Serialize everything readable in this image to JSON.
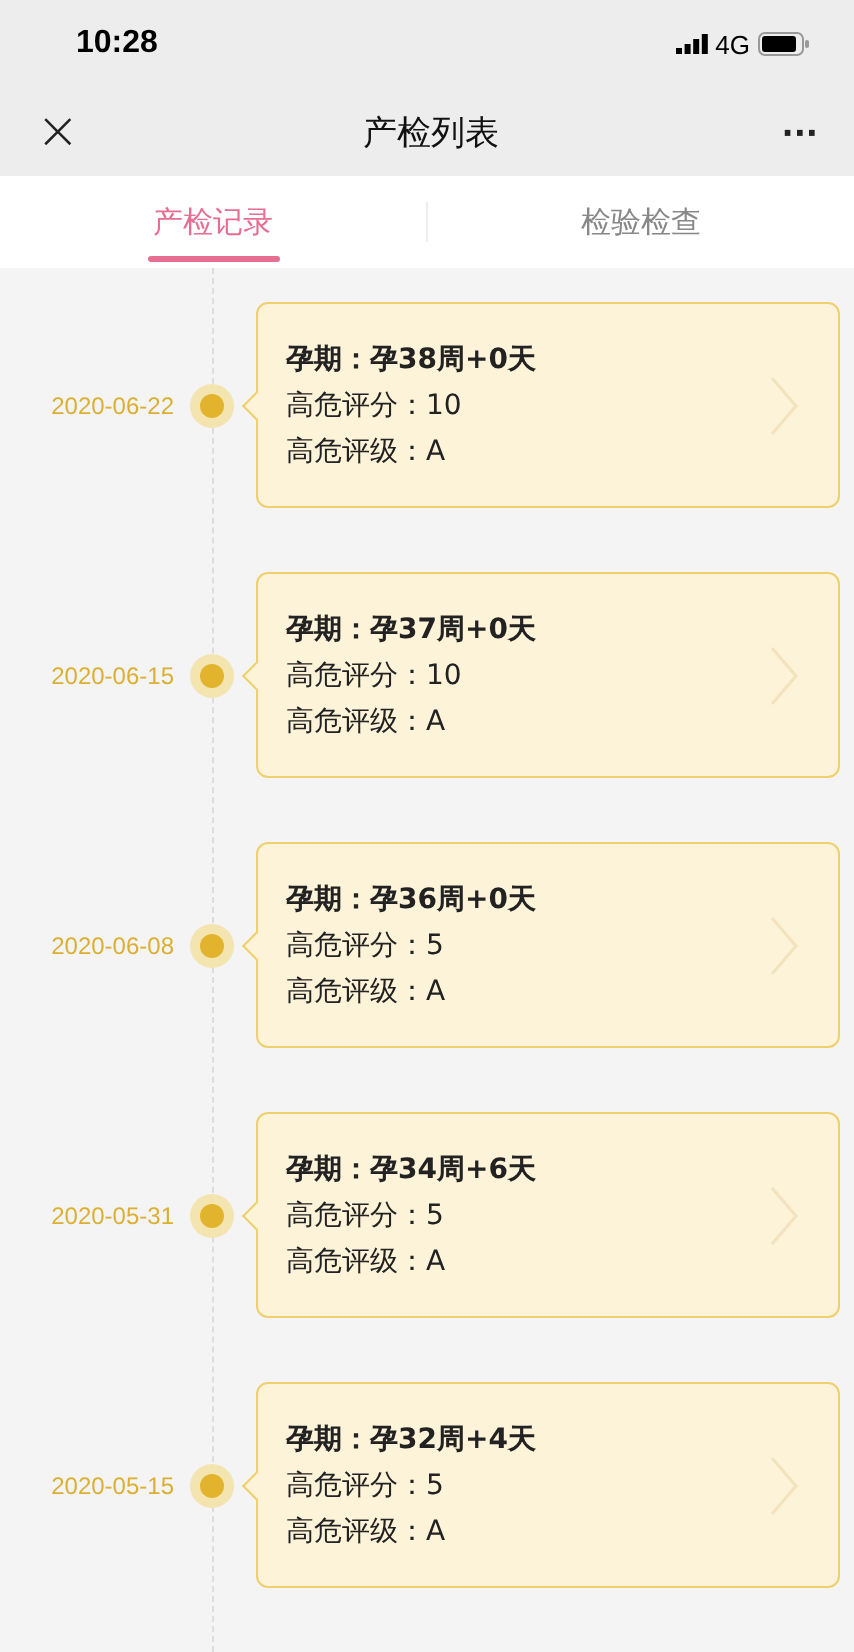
{
  "status_bar": {
    "time": "10:28",
    "network": "4G"
  },
  "nav": {
    "close": "×",
    "title": "产检列表",
    "more": "···"
  },
  "tabs": [
    {
      "label": "产检记录",
      "selected": true
    },
    {
      "label": "检验检查",
      "selected": false
    }
  ],
  "records": [
    {
      "date": "2020-06-22",
      "period": "孕期：孕38周+0天",
      "score": "高危评分：10",
      "grade": "高危评级：A"
    },
    {
      "date": "2020-06-15",
      "period": "孕期：孕37周+0天",
      "score": "高危评分：10",
      "grade": "高危评级：A"
    },
    {
      "date": "2020-06-08",
      "period": "孕期：孕36周+0天",
      "score": "高危评分：5",
      "grade": "高危评级：A"
    },
    {
      "date": "2020-05-31",
      "period": "孕期：孕34周+6天",
      "score": "高危评分：5",
      "grade": "高危评级：A"
    },
    {
      "date": "2020-05-15",
      "period": "孕期：孕32周+4天",
      "score": "高危评分：5",
      "grade": "高危评级：A"
    }
  ]
}
